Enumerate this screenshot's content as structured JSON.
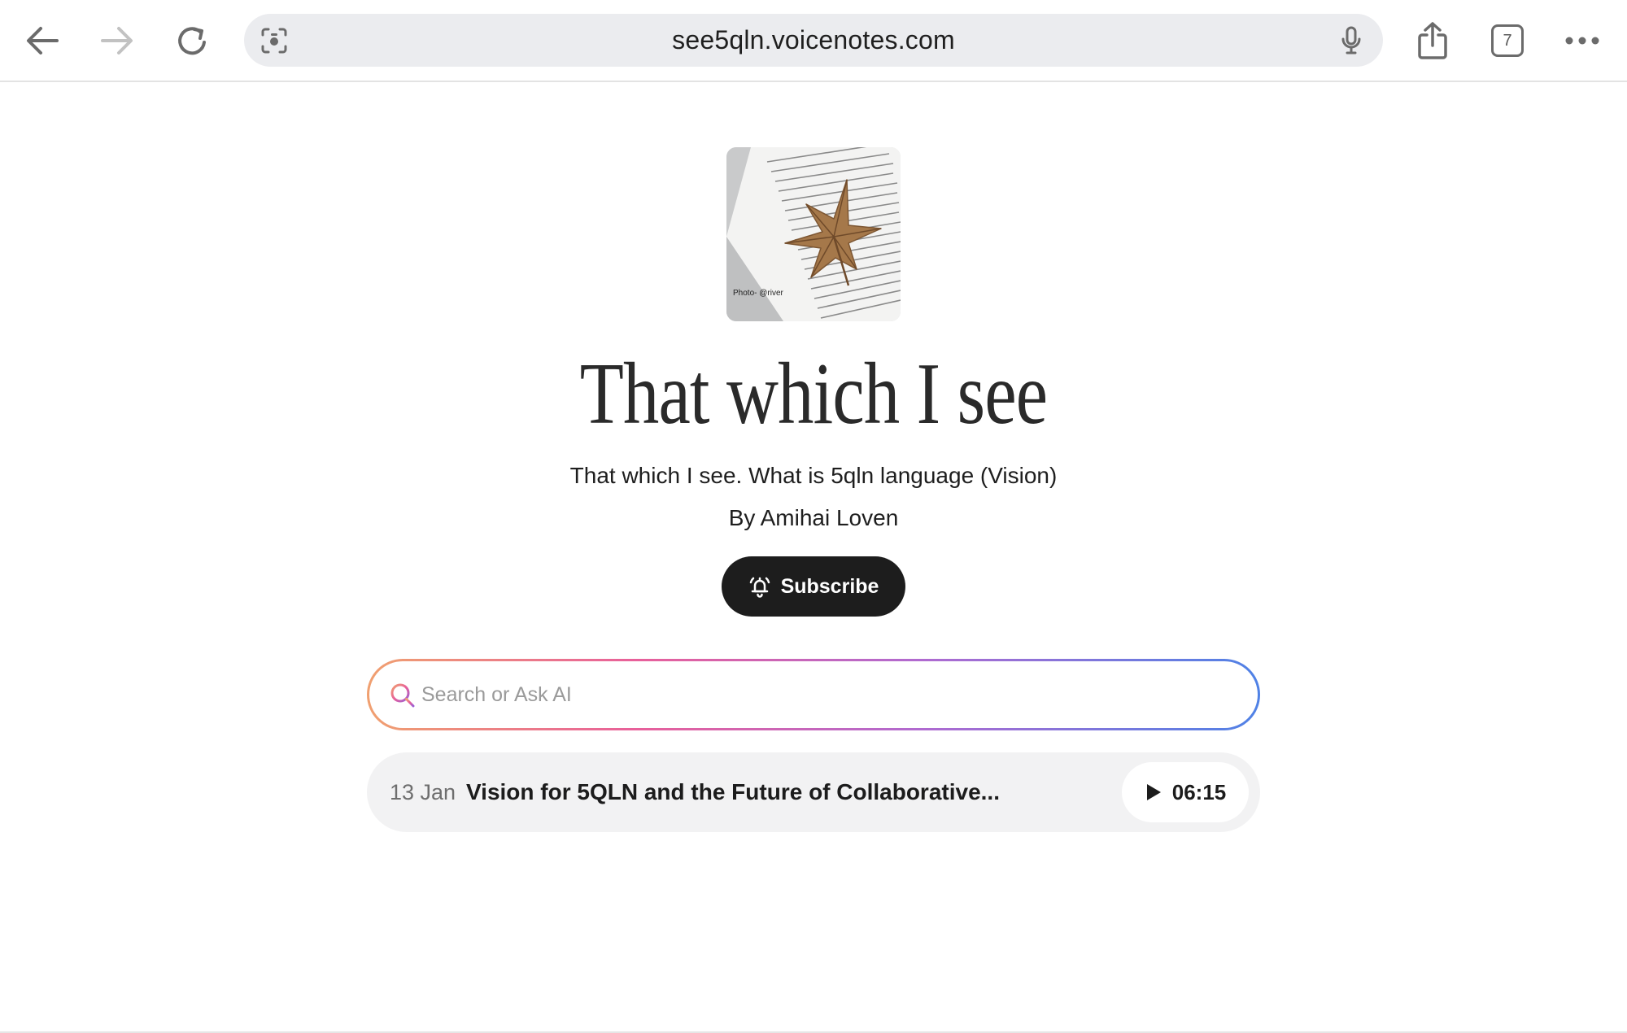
{
  "browser": {
    "url": "see5qln.voicenotes.com",
    "tab_count": "7",
    "icons": {
      "back": "back-arrow-icon",
      "forward": "forward-arrow-icon",
      "reload": "reload-icon",
      "lens": "camera-lens-icon",
      "mic": "microphone-icon",
      "share": "share-icon",
      "more": "more-dots-icon"
    }
  },
  "page": {
    "cover_watermark": "Photo- @river",
    "title": "That which I see",
    "subtitle": "That which I see. What is 5qln language (Vision)",
    "author": "By Amihai Loven",
    "subscribe_label": "Subscribe"
  },
  "search": {
    "placeholder": "Search or Ask AI",
    "value": ""
  },
  "notes": [
    {
      "date": "13 Jan",
      "title": "Vision for 5QLN and the Future of Collaborative...",
      "duration": "06:15"
    }
  ],
  "colors": {
    "button_dark": "#1d1d1d",
    "row_bg": "#f2f2f3",
    "search_gradient": [
      "#f0a070",
      "#e8609a",
      "#b06ad0",
      "#4f82e6"
    ]
  }
}
